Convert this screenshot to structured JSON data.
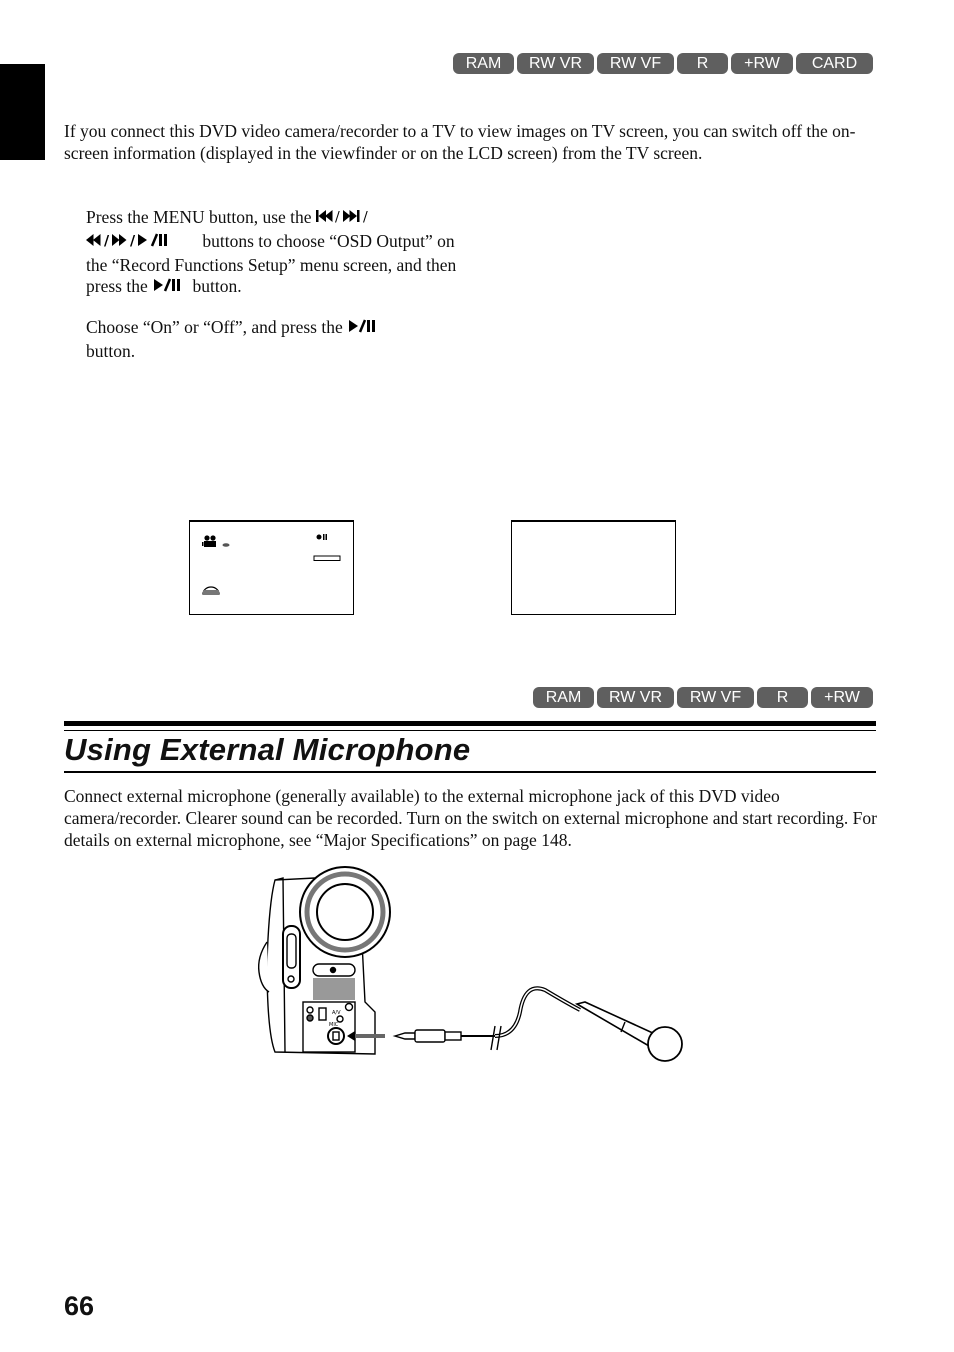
{
  "section_tab": "section-marker",
  "top_badges": [
    "RAM",
    "RW VR",
    "RW VF",
    "R",
    "+RW",
    "CARD"
  ],
  "intro": "If you connect this DVD video camera/recorder to a TV to view images on TV screen, you can switch off the on-screen information (displayed in the viewfinder or on the LCD screen) from the TV screen.",
  "steps": [
    {
      "a": "Press the MENU button, use the ",
      "sym1": "⏮/⏭/",
      "b": " ",
      "sym2": "⏪/⏩/⏯",
      "c": " buttons to choose “OSD Output” on the “Record Functions Setup” menu screen, and then press the ",
      "sym3": "⏯",
      "d": " button."
    },
    {
      "a": "Choose “On” or “Off”, and press the ",
      "sym1": "⏯",
      "b": " button."
    }
  ],
  "screens": {
    "on_icons": [
      "camera-mode-icon",
      "record-pause-icon",
      "battery-icon",
      "disc-icon"
    ],
    "off_icons": []
  },
  "mid_badges": [
    "RAM",
    "RW VR",
    "RW VF",
    "R",
    "+RW"
  ],
  "heading": "Using External Microphone",
  "body": "Connect external microphone (generally available) to the external microphone jack of this DVD video camera/recorder. Clearer sound can be recorded. Turn on the switch on external microphone and start recording. For details on external microphone, see “Major Specifications” on page 148.",
  "illustration_labels": {
    "av": "A/V",
    "mic": "MIC"
  },
  "page_number": "66"
}
